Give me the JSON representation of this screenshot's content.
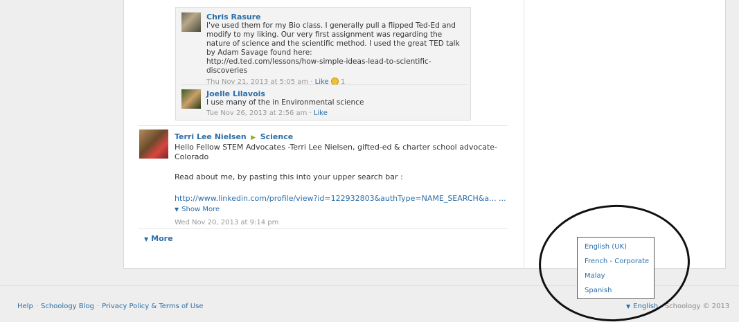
{
  "comments": [
    {
      "author": "Chris Rasure",
      "text": "I've used them for my Bio class. I generally pull a flipped Ted-Ed and modify to my liking. Our very first assignment was regarding the nature of science and the scientific method. I used the great TED talk by Adam Savage found here:",
      "url": "http://ed.ted.com/lessons/how-simple-ideas-lead-to-scientific-discoveries",
      "date": "Thu Nov 21, 2013 at 5:05 am",
      "like_label": "Like",
      "like_count": "1"
    },
    {
      "author": "Joelle Lilavois",
      "text": "I use many of the in Environmental science",
      "date": "Tue Nov 26, 2013 at 2:56 am",
      "like_label": "Like"
    }
  ],
  "post": {
    "author": "Terri Lee Nielsen",
    "group": "Science",
    "line1": "Hello Fellow STEM Advocates -Terri Lee Nielsen, gifted-ed & charter school advocate-Colorado",
    "line2": "Read about me, by pasting this into your upper search bar :",
    "url": "http://www.linkedin.com/profile/view?id=122932803&authType=NAME_SEARCH&a... ...",
    "show_more": "Show More",
    "date": "Wed Nov 20, 2013 at 9:14 pm"
  },
  "more_label": "More",
  "language_menu": {
    "options": [
      "English (UK)",
      "French - Corporate",
      "Malay",
      "Spanish"
    ]
  },
  "footer": {
    "links": [
      "Help",
      "Schoology Blog",
      "Privacy Policy & Terms of Use"
    ],
    "current_language": "English",
    "copyright": "Schoology © 2013"
  }
}
